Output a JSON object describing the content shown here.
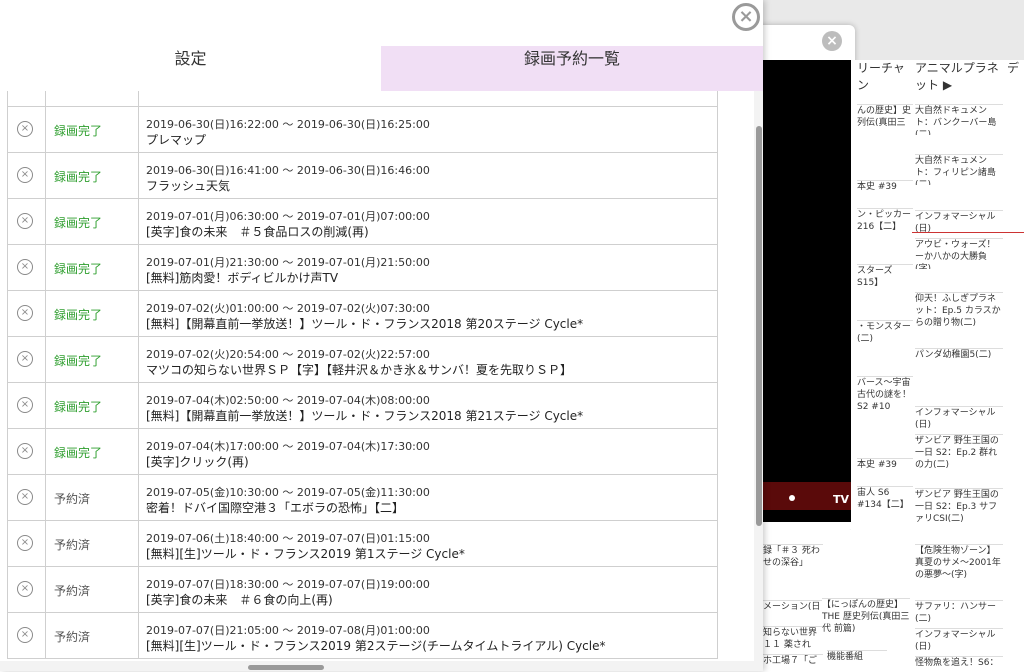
{
  "modal": {
    "close_symbol": "×",
    "tabs": [
      {
        "label": "設定",
        "active": false
      },
      {
        "label": "録画予約一覧",
        "active": true
      }
    ]
  },
  "reservations": [
    {
      "status": "録画完了",
      "done": true,
      "time": "2019-06-30(日)16:22:00 ～ 2019-06-30(日)16:25:00",
      "title": "プレマップ"
    },
    {
      "status": "録画完了",
      "done": true,
      "time": "2019-06-30(日)16:41:00 ～ 2019-06-30(日)16:46:00",
      "title": "フラッシュ天気"
    },
    {
      "status": "録画完了",
      "done": true,
      "time": "2019-07-01(月)06:30:00 ～ 2019-07-01(月)07:00:00",
      "title": "[英字]食の未来　＃５食品ロスの削減(再)"
    },
    {
      "status": "録画完了",
      "done": true,
      "time": "2019-07-01(月)21:30:00 ～ 2019-07-01(月)21:50:00",
      "title": "[無料]筋肉愛！ボディビルかけ声TV"
    },
    {
      "status": "録画完了",
      "done": true,
      "time": "2019-07-02(火)01:00:00 ～ 2019-07-02(火)07:30:00",
      "title": "[無料]【開幕直前一挙放送！】ツール・ド・フランス2018 第20ステージ Cycle*"
    },
    {
      "status": "録画完了",
      "done": true,
      "time": "2019-07-02(火)20:54:00 ～ 2019-07-02(火)22:57:00",
      "title": "マツコの知らない世界ＳＰ【字】【軽井沢＆かき氷＆サンバ！夏を先取りＳＰ】"
    },
    {
      "status": "録画完了",
      "done": true,
      "time": "2019-07-04(木)02:50:00 ～ 2019-07-04(木)08:00:00",
      "title": "[無料]【開幕直前一挙放送！】ツール・ド・フランス2018 第21ステージ Cycle*"
    },
    {
      "status": "録画完了",
      "done": true,
      "time": "2019-07-04(木)17:00:00 ～ 2019-07-04(木)17:30:00",
      "title": "[英字]クリック(再)"
    },
    {
      "status": "予約済",
      "done": false,
      "time": "2019-07-05(金)10:30:00 ～ 2019-07-05(金)11:30:00",
      "title": "密着！ドバイ国際空港３「エボラの恐怖」【二】"
    },
    {
      "status": "予約済",
      "done": false,
      "time": "2019-07-06(土)18:40:00 ～ 2019-07-07(日)01:15:00",
      "title": "[無料][生]ツール・ド・フランス2019 第1ステージ Cycle*"
    },
    {
      "status": "予約済",
      "done": false,
      "time": "2019-07-07(日)18:30:00 ～ 2019-07-07(日)19:00:00",
      "title": "[英字]食の未来　＃６食の向上(再)"
    },
    {
      "status": "予約済",
      "done": false,
      "time": "2019-07-07(日)21:05:00 ～ 2019-07-08(月)01:00:00",
      "title": "[無料][生]ツール・ド・フランス2019 第2ステージ(チームタイムトライアル) Cycle*"
    }
  ],
  "background": {
    "close_symbol": "×",
    "video_label": "TV",
    "channels": [
      "リーチャン",
      "アニマルプラネット ▶",
      "デ"
    ],
    "cells_col1": [
      "んの歴史】史列伝(真田三",
      "本史 #39",
      "ン・ピッカー216【二】",
      "スターズ S15】",
      "・モンスター(二)",
      "バース〜宇宙古代の謎を！S2 #10",
      "本史 #39",
      "宙人 S6 #134【二】",
      "【にっぽんの歴史】THE 歴史列伝(真田三代 前篇)"
    ],
    "cells_col2": [
      "大自然ドキュメント：バンクーバー島(二)",
      "大自然ドキュメント：フィリピン諸島(二)",
      "インフォマーシャル(日)",
      "アウビ・ウォーズ！ーか八かの大勝負(字)",
      "仰天！ふしぎプラネット：Ep.5 カラスからの贈り物(二)",
      "パンダ幼稚園5(二)",
      "インフォマーシャル(日)",
      "ザンビア 野生王国の一日 S2：Ep.2 群れの力(二)",
      "ザンビア 野生王国の一日 S2：Ep.3 サファリCSI(二)",
      "【危険生物ゾーン】真夏のサメ〜2001年の悪夢〜(字)",
      "サファリ：ハンサー(二)",
      "インフォマーシャル(日)",
      "怪物魚を追え！S6："
    ],
    "cells_left": [
      "録「＃３ 死わせの深谷」",
      "メーション(日",
      "知らない世界１１ 薬され",
      "ホ工場７「ご",
      "機能番組"
    ]
  }
}
